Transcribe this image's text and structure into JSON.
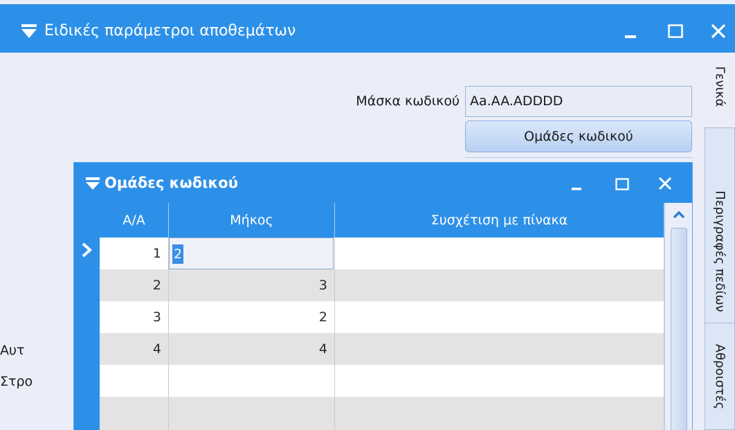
{
  "window": {
    "title": "Ειδικές παράμετροι αποθεμάτων",
    "title_bar_color": "#2d90e8"
  },
  "form": {
    "mask_label": "Μάσκα κωδικού",
    "mask_value": "Aa.AA.ADDDD",
    "groups_button": "Ομάδες κωδικού",
    "cut_label_1": "Αυτ",
    "cut_label_2": "Στρο"
  },
  "side_tabs": [
    {
      "label": "Γενικά",
      "active": true
    },
    {
      "label": "Περιγραφές πεδίων",
      "active": false
    },
    {
      "label": "Αθροιστές",
      "active": false
    }
  ],
  "dialog": {
    "title": "Ομάδες κωδικού",
    "columns": [
      "Α/Α",
      "Μήκος",
      "Συσχέτιση με πίνακα"
    ],
    "rows": [
      {
        "aa": "1",
        "length": "2",
        "relation": "",
        "editing": true
      },
      {
        "aa": "2",
        "length": "3",
        "relation": ""
      },
      {
        "aa": "3",
        "length": "2",
        "relation": ""
      },
      {
        "aa": "4",
        "length": "4",
        "relation": ""
      },
      {
        "aa": "",
        "length": "",
        "relation": ""
      },
      {
        "aa": "",
        "length": "",
        "relation": ""
      }
    ]
  },
  "icons": {
    "menu": "chevron-down-icon",
    "minimize": "minimize-icon",
    "maximize": "maximize-icon",
    "close": "close-icon",
    "row_pointer": "row-pointer-icon",
    "scroll_up": "scroll-up-icon"
  }
}
